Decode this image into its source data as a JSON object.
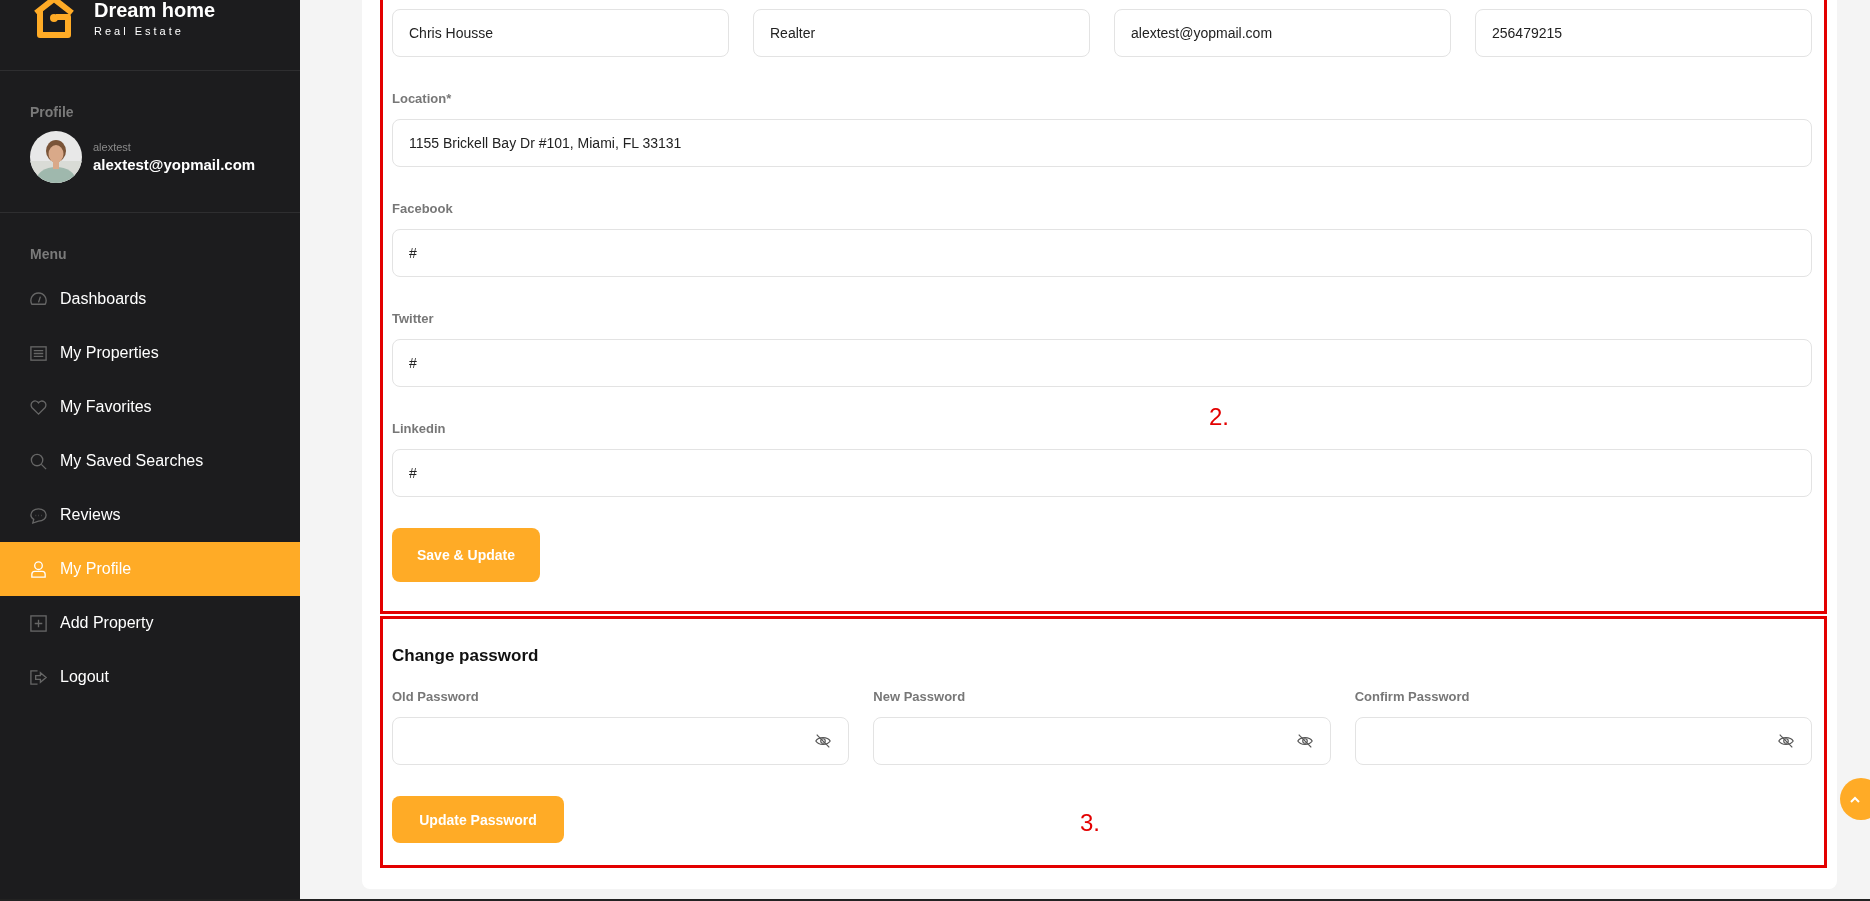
{
  "brand": {
    "name": "Dream home",
    "tagline": "Real Estate"
  },
  "profile": {
    "heading": "Profile",
    "username": "alextest",
    "email": "alextest@yopmail.com"
  },
  "menu": {
    "heading": "Menu",
    "items": [
      {
        "label": "Dashboards",
        "selected": false
      },
      {
        "label": "My Properties",
        "selected": false
      },
      {
        "label": "My Favorites",
        "selected": false
      },
      {
        "label": "My Saved Searches",
        "selected": false
      },
      {
        "label": "Reviews",
        "selected": false
      },
      {
        "label": "My Profile",
        "selected": true
      },
      {
        "label": "Add Property",
        "selected": false
      },
      {
        "label": "Logout",
        "selected": false
      }
    ]
  },
  "profile_form": {
    "top_fields": [
      {
        "value": "Chris Housse"
      },
      {
        "value": "Realter"
      },
      {
        "value": "alextest@yopmail.com"
      },
      {
        "value": "256479215"
      }
    ],
    "fields": [
      {
        "label": "Location*",
        "value": "1155 Brickell Bay Dr #101, Miami, FL 33131"
      },
      {
        "label": "Facebook",
        "value": "#"
      },
      {
        "label": "Twitter",
        "value": "#"
      },
      {
        "label": "Linkedin",
        "value": "#"
      }
    ],
    "save_button": "Save & Update",
    "annotation": "2."
  },
  "password_form": {
    "title": "Change password",
    "fields": [
      {
        "label": "Old Password"
      },
      {
        "label": "New Password"
      },
      {
        "label": "Confirm Password"
      }
    ],
    "button": "Update Password",
    "annotation": "3."
  }
}
